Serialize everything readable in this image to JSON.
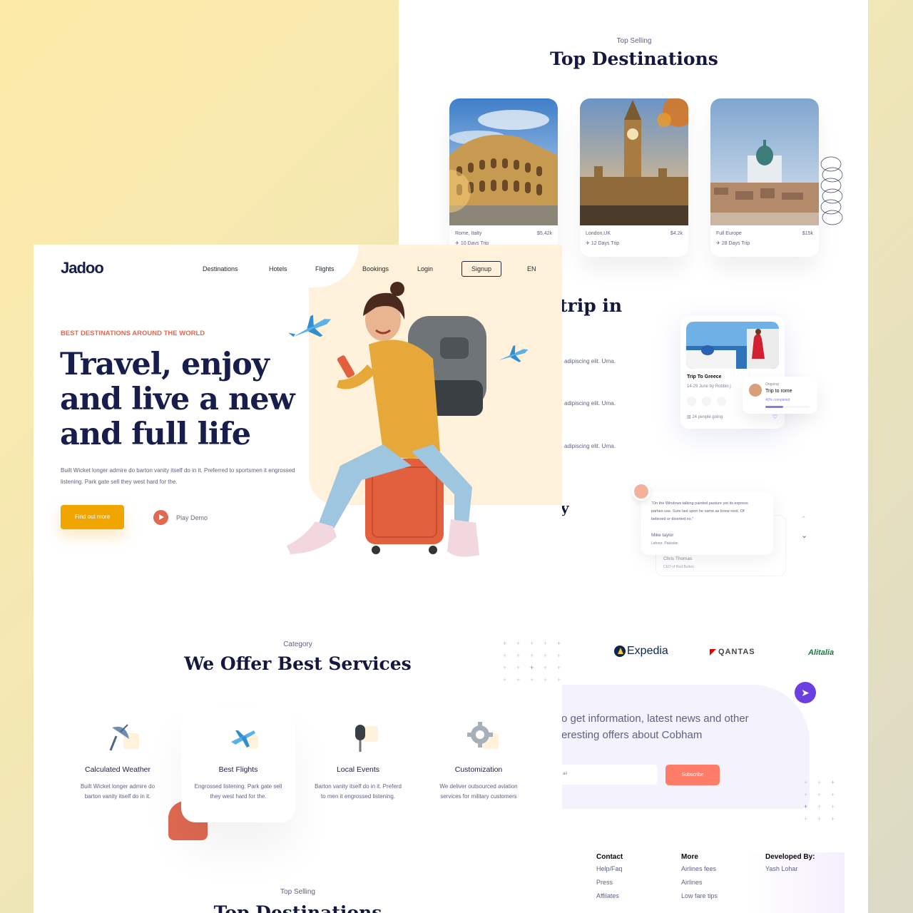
{
  "back": {
    "kicker": "Top Selling",
    "title": "Top Destinations",
    "destinations": [
      {
        "place": "Rome, Italty",
        "price": "$5,42k",
        "trip": "10 Days Trip"
      },
      {
        "place": "London,UK",
        "price": "$4.2k",
        "trip": "12 Days Trip"
      },
      {
        "place": "Full Europe",
        "price": "$15k",
        "trip": "28 Days Trip"
      }
    ],
    "booking_partial_title": "trip in",
    "booking_lines": [
      "adipiscing elit. Urna.",
      "adipiscing elit. Urna.",
      "adipiscing elit. Urna."
    ],
    "partial_letter": "y",
    "trip_card": {
      "title": "Trip To Greece",
      "sub": "14-29 June   by Robbin j",
      "people": "24 people going",
      "ongoing_label": "Ongoing",
      "ongoing_title": "Trip to rome",
      "ongoing_pct_text": "40% completed",
      "ongoing_progress": 0.4
    },
    "testimonial": {
      "quote": "“On the Windows talking painted pasture yet its express parties use. Sure last upon he same as knew next. Of believed or diverted no.”",
      "name": "Mike taylor",
      "place": "Lahore, Pakistan",
      "name2": "Chris Thomas",
      "place2": "CEO of Red Button"
    },
    "partners": {
      "expedia": "Expedia",
      "qantas": "QANTAS",
      "alitalia": "Alitalia"
    },
    "subscribe": {
      "text": "o get information, latest news and other\neresting offers about Cobham",
      "placeholder": "ail",
      "button": "Subscribe"
    },
    "footer": {
      "contact": {
        "heading": "Contact",
        "links": [
          "Help/Faq",
          "Press",
          "Affilates"
        ]
      },
      "more": {
        "heading": "More",
        "links": [
          "Airlines fees",
          "Airlines",
          "Low fare tips"
        ]
      },
      "dev": {
        "heading": "Developed By:",
        "name": "Yash Lohar"
      }
    }
  },
  "front": {
    "logo": "Jadoo",
    "nav": [
      "Destinations",
      "Hotels",
      "Flights",
      "Bookings",
      "Login"
    ],
    "signup": "Signup",
    "lang": "EN",
    "kicker": "BEST DESTINATIONS AROUND THE WORLD",
    "headline": "Travel, enjoy and live a new and full life",
    "description": "Built Wicket longer admire do barton vanity itself do in it. Preferred to sportsmen it engrossed listening. Park gate sell they west hard for the.",
    "cta": "Find out more",
    "play": "Play Demo",
    "services_kicker": "Category",
    "services_title": "We Offer Best Services",
    "services": [
      {
        "name": "Calculated Weather",
        "desc": "Built Wicket longer admire do barton vanity itself do in it."
      },
      {
        "name": "Best Flights",
        "desc": "Engrossed listening. Park gate sell they west hard for the."
      },
      {
        "name": "Local Events",
        "desc": "Barton vanity itself do in it. Preferd to men it engrossed listening."
      },
      {
        "name": "Customization",
        "desc": "We deliver outsourced aviation services for military customers"
      }
    ],
    "bottom_kicker": "Top Selling",
    "bottom_title": "Top Destinations"
  },
  "colors": {
    "accent": "#df6951",
    "cta": "#f1a501",
    "navy": "#181e4b",
    "purple": "#6c3fe0"
  }
}
